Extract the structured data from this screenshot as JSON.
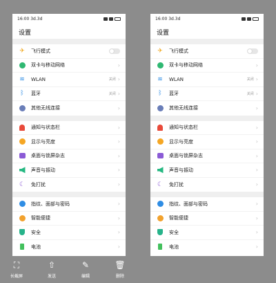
{
  "screens": [
    {
      "status": {
        "time": "16:00",
        "network": "3d.3d"
      },
      "title": "设置",
      "groups": [
        [
          {
            "label": "飞行模式",
            "icon": "airplane-icon",
            "control": "toggle"
          },
          {
            "label": "双卡与移动网络",
            "icon": "globe-icon"
          },
          {
            "label": "WLAN",
            "icon": "wifi-icon",
            "value": "关闭"
          },
          {
            "label": "蓝牙",
            "icon": "bluetooth-icon",
            "value": "关闭"
          },
          {
            "label": "其他无线连接",
            "icon": "link-icon"
          }
        ],
        [
          {
            "label": "通知与状态栏",
            "icon": "bell-icon"
          },
          {
            "label": "显示与亮度",
            "icon": "sun-icon"
          },
          {
            "label": "桌面与锁屏杂志",
            "icon": "desktop-icon"
          },
          {
            "label": "声音与振动",
            "icon": "speaker-icon"
          },
          {
            "label": "免打扰",
            "icon": "moon-icon"
          }
        ],
        [
          {
            "label": "指纹、面部与密码",
            "icon": "fingerprint-icon"
          },
          {
            "label": "智能便捷",
            "icon": "smart-icon"
          },
          {
            "label": "安全",
            "icon": "shield-icon"
          },
          {
            "label": "电池",
            "icon": "battery-icon"
          }
        ]
      ]
    },
    {
      "status": {
        "time": "16:00",
        "network": "3d.3d"
      },
      "title": "设置",
      "groups": [
        [
          {
            "label": "飞行模式",
            "icon": "airplane-icon",
            "control": "toggle"
          },
          {
            "label": "双卡与移动网络",
            "icon": "globe-icon"
          },
          {
            "label": "WLAN",
            "icon": "wifi-icon",
            "value": "关闭"
          },
          {
            "label": "蓝牙",
            "icon": "bluetooth-icon",
            "value": "关闭"
          },
          {
            "label": "其他无线连接",
            "icon": "link-icon"
          }
        ],
        [
          {
            "label": "通知与状态栏",
            "icon": "bell-icon"
          },
          {
            "label": "显示与亮度",
            "icon": "sun-icon"
          },
          {
            "label": "桌面与锁屏杂志",
            "icon": "desktop-icon"
          },
          {
            "label": "声音与振动",
            "icon": "speaker-icon"
          },
          {
            "label": "免打扰",
            "icon": "moon-icon"
          }
        ],
        [
          {
            "label": "指纹、面部与密码",
            "icon": "fingerprint-icon"
          },
          {
            "label": "智能便捷",
            "icon": "smart-icon"
          },
          {
            "label": "安全",
            "icon": "shield-icon"
          },
          {
            "label": "电池",
            "icon": "battery-icon"
          }
        ]
      ]
    }
  ],
  "toolbar": {
    "items": [
      {
        "label": "长截屏",
        "icon": "crop-icon"
      },
      {
        "label": "发送",
        "icon": "share-icon"
      },
      {
        "label": "编辑",
        "icon": "pen-icon"
      },
      {
        "label": "删除",
        "icon": "trash-icon"
      }
    ]
  }
}
